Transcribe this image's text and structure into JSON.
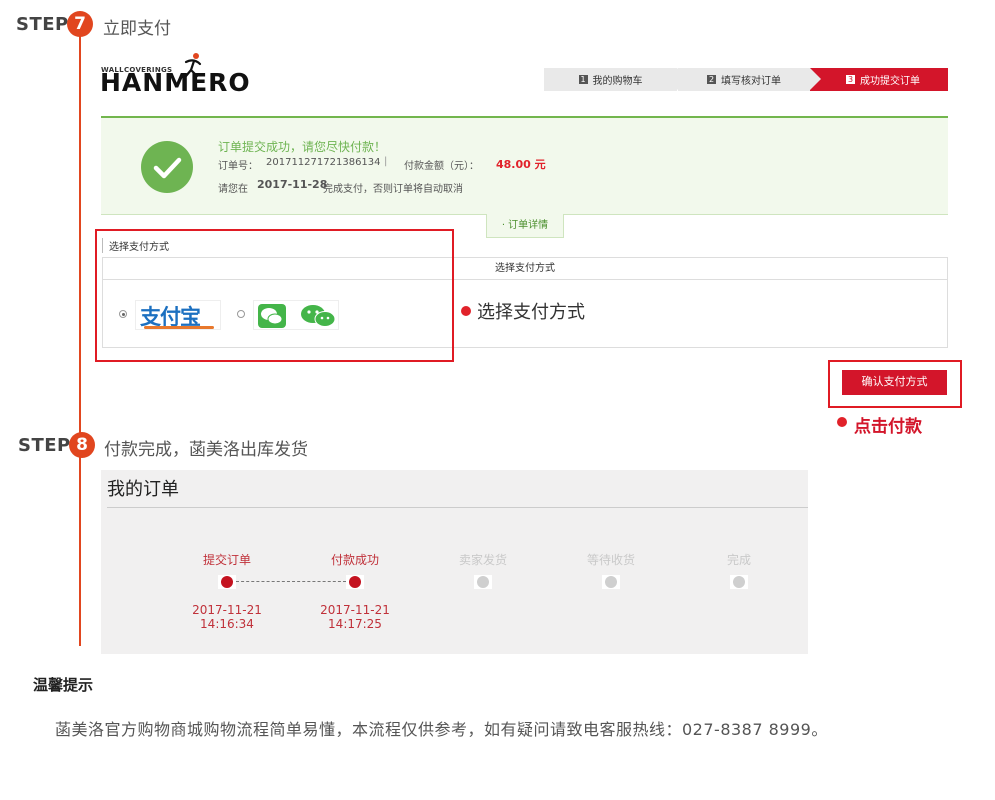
{
  "step7": {
    "label": "STEP",
    "number": "7",
    "title": "立即支付"
  },
  "brand": {
    "small": "WALLCOVERINGS",
    "name": "HANMERO"
  },
  "progress": [
    {
      "num": "1",
      "label": "我的购物车"
    },
    {
      "num": "2",
      "label": "填写核对订单"
    },
    {
      "num": "3",
      "label": "成功提交订单"
    }
  ],
  "success": {
    "headline": "订单提交成功，请您尽快付款！",
    "order_no_label": "订单号：",
    "order_no": "201711271721386134",
    "separator": "|",
    "amount_label": "付款金额（元）：",
    "amount": "48.00 元",
    "deadline_prefix": "请您在",
    "deadline_date": "2017-11-28",
    "deadline_suffix": "完成支付，否则订单将自动取消"
  },
  "order_details_tab": "· 订单详情",
  "payment": {
    "section_label": "选择支付方式",
    "header": "选择支付方式",
    "alipay_label": "支付宝",
    "annotation": "选择支付方式"
  },
  "confirm": {
    "button": "确认支付方式",
    "annotation": "点击付款"
  },
  "step8": {
    "label": "STEP",
    "number": "8",
    "title": "付款完成，菡美洛出库发货"
  },
  "my_orders": {
    "title": "我的订单",
    "steps": [
      {
        "label": "提交订单",
        "status": "done",
        "date": "2017-11-21",
        "time": "14:16:34"
      },
      {
        "label": "付款成功",
        "status": "done",
        "date": "2017-11-21",
        "time": "14:17:25"
      },
      {
        "label": "卖家发货",
        "status": "pending"
      },
      {
        "label": "等待收货",
        "status": "pending"
      },
      {
        "label": "完成",
        "status": "pending"
      }
    ]
  },
  "tips": {
    "title": "温馨提示",
    "text": "菡美洛官方购物商城购物流程简单易懂，本流程仅供参考，如有疑问请致电客服热线：027-8387 8999。"
  },
  "colors": {
    "accent": "#e1461f",
    "brand_red": "#d3152a",
    "success_green": "#6eb452"
  }
}
